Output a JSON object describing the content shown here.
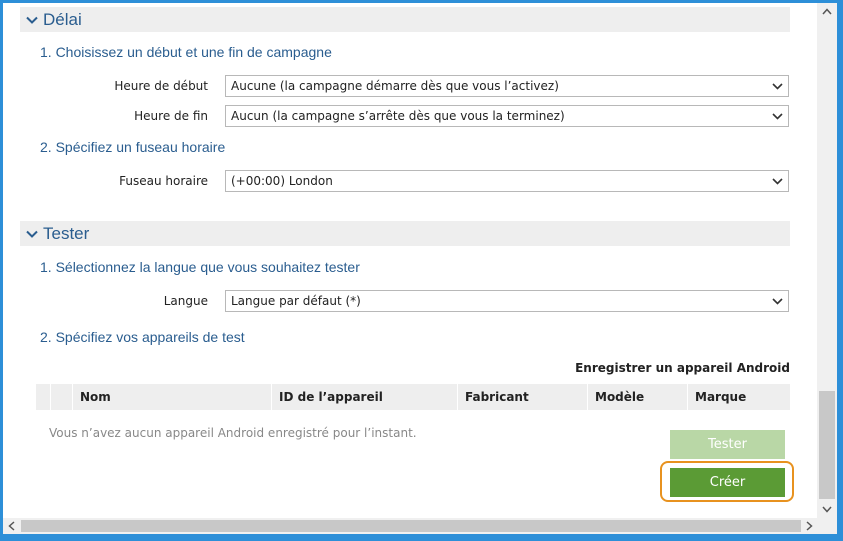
{
  "delai": {
    "title": "Délai",
    "step1": "1. Choisissez un début et une fin de campagne",
    "start_label": "Heure de début",
    "start_value": "Aucune (la campagne démarre dès que vous l’activez)",
    "end_label": "Heure de fin",
    "end_value": "Aucun (la campagne s’arrête dès que vous la terminez)",
    "step2": "2. Spécifiez un fuseau horaire",
    "tz_label": "Fuseau horaire",
    "tz_value": "(+00:00) London"
  },
  "tester": {
    "title": "Tester",
    "step1": "1. Sélectionnez la langue que vous souhaitez tester",
    "lang_label": "Langue",
    "lang_value": "Langue par défaut (*)",
    "step2": "2. Spécifiez vos appareils de test",
    "register_link": "Enregistrer un appareil Android",
    "columns": [
      "Nom",
      "ID de l’appareil",
      "Fabricant",
      "Modèle",
      "Marque"
    ],
    "empty_message": "Vous n’avez aucun appareil Android enregistré pour l’instant.",
    "test_button": "Tester",
    "create_button": "Créer"
  },
  "colors": {
    "accent": "#2d8fd8",
    "heading": "#2a5d8f",
    "create": "#5b9b35",
    "test_disabled": "#b9d7a6",
    "focus": "#e8921f"
  },
  "icons": [
    "chevron-down-icon",
    "scroll-up-icon",
    "scroll-down-icon",
    "scroll-left-icon",
    "scroll-right-icon"
  ]
}
